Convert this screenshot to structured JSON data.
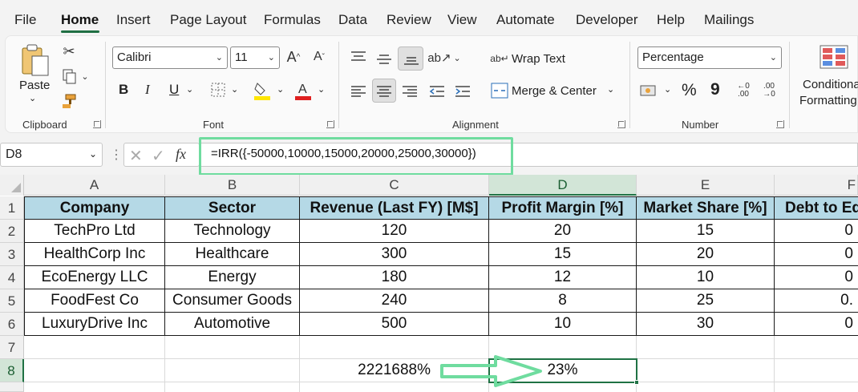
{
  "menu": {
    "items": [
      "File",
      "Home",
      "Insert",
      "Page Layout",
      "Formulas",
      "Data",
      "Review",
      "View",
      "Automate",
      "Developer",
      "Help",
      "Mailings"
    ]
  },
  "ribbon": {
    "clipboard": {
      "paste_label": "Paste",
      "group_label": "Clipboard"
    },
    "font": {
      "font_name": "Calibri",
      "font_size": "11",
      "bold": "B",
      "italic": "I",
      "underline": "U",
      "group_label": "Font"
    },
    "alignment": {
      "wrap_text": "Wrap Text",
      "merge_center": "Merge & Center",
      "group_label": "Alignment"
    },
    "number": {
      "format": "Percentage",
      "percent": "%",
      "comma": "9",
      "group_label": "Number"
    },
    "styles": {
      "conditional_line1": "Conditional",
      "conditional_line2": "Formatting"
    }
  },
  "formula_bar": {
    "name_box": "D8",
    "fx": "fx",
    "formula": "=IRR({-50000,10000,15000,20000,25000,30000})"
  },
  "sheet": {
    "columns": [
      "A",
      "B",
      "C",
      "D",
      "E",
      "F"
    ],
    "rows": [
      "1",
      "2",
      "3",
      "4",
      "5",
      "6",
      "7",
      "8"
    ],
    "headers": [
      "Company",
      "Sector",
      "Revenue (Last FY) [M$]",
      "Profit Margin [%]",
      "Market Share [%]",
      "Debt to Eq"
    ],
    "data": [
      [
        "TechPro Ltd",
        "Technology",
        "120",
        "20",
        "15",
        "0"
      ],
      [
        "HealthCorp Inc",
        "Healthcare",
        "300",
        "15",
        "20",
        "0"
      ],
      [
        "EcoEnergy LLC",
        "Energy",
        "180",
        "12",
        "10",
        "0"
      ],
      [
        "FoodFest Co",
        "Consumer Goods",
        "240",
        "8",
        "25",
        "0."
      ],
      [
        "LuxuryDrive Inc",
        "Automotive",
        "500",
        "10",
        "30",
        "0"
      ]
    ],
    "c8": "2221688%",
    "d8": "23%"
  },
  "colors": {
    "accent": "#1f7244",
    "header_fill": "#b5d9e6",
    "highlight": "#6fdc9f",
    "font_color_bar": "#e02020",
    "fill_color_bar": "#ffe600"
  }
}
